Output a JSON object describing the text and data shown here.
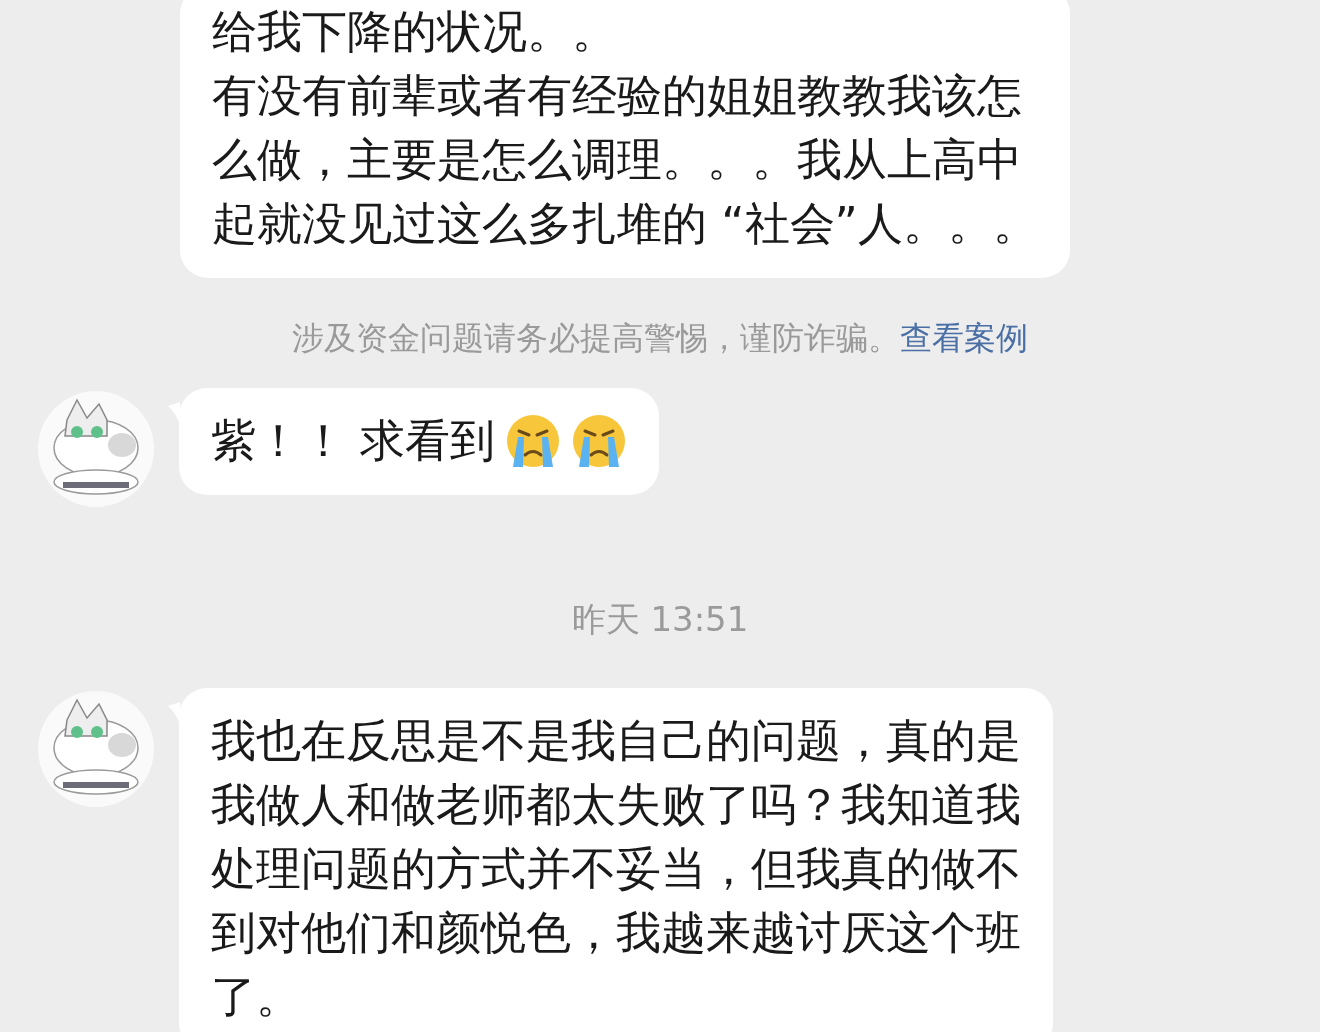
{
  "messages": [
    {
      "kind": "text",
      "avatar": false,
      "lines": [
        "给我下降的状况。。",
        "有没有前辈或者有经验的姐姐教教我该怎",
        "么做，主要是怎么调理。。。我从上高中",
        "起就没见过这么多扎堆的 “社会”人。。。"
      ]
    },
    {
      "kind": "notice",
      "text": "涉及资金问题请务必提高警惕，谨防诈骗。",
      "link": "查看案例"
    },
    {
      "kind": "text",
      "avatar": true,
      "lines": [
        "紫！！ 求看到"
      ],
      "emojis": [
        {
          "kind": "crying"
        },
        {
          "kind": "crying"
        }
      ]
    },
    {
      "kind": "time",
      "text": "昨天 13:51"
    },
    {
      "kind": "text",
      "avatar": true,
      "lines": [
        "我也在反思是不是我自己的问题，真的是",
        "我做人和做老师都太失败了吗？我知道我",
        "处理问题的方式并不妥当，但我真的做不",
        "到对他们和颜悦色，我越来越讨厌这个班",
        "了。"
      ]
    }
  ]
}
